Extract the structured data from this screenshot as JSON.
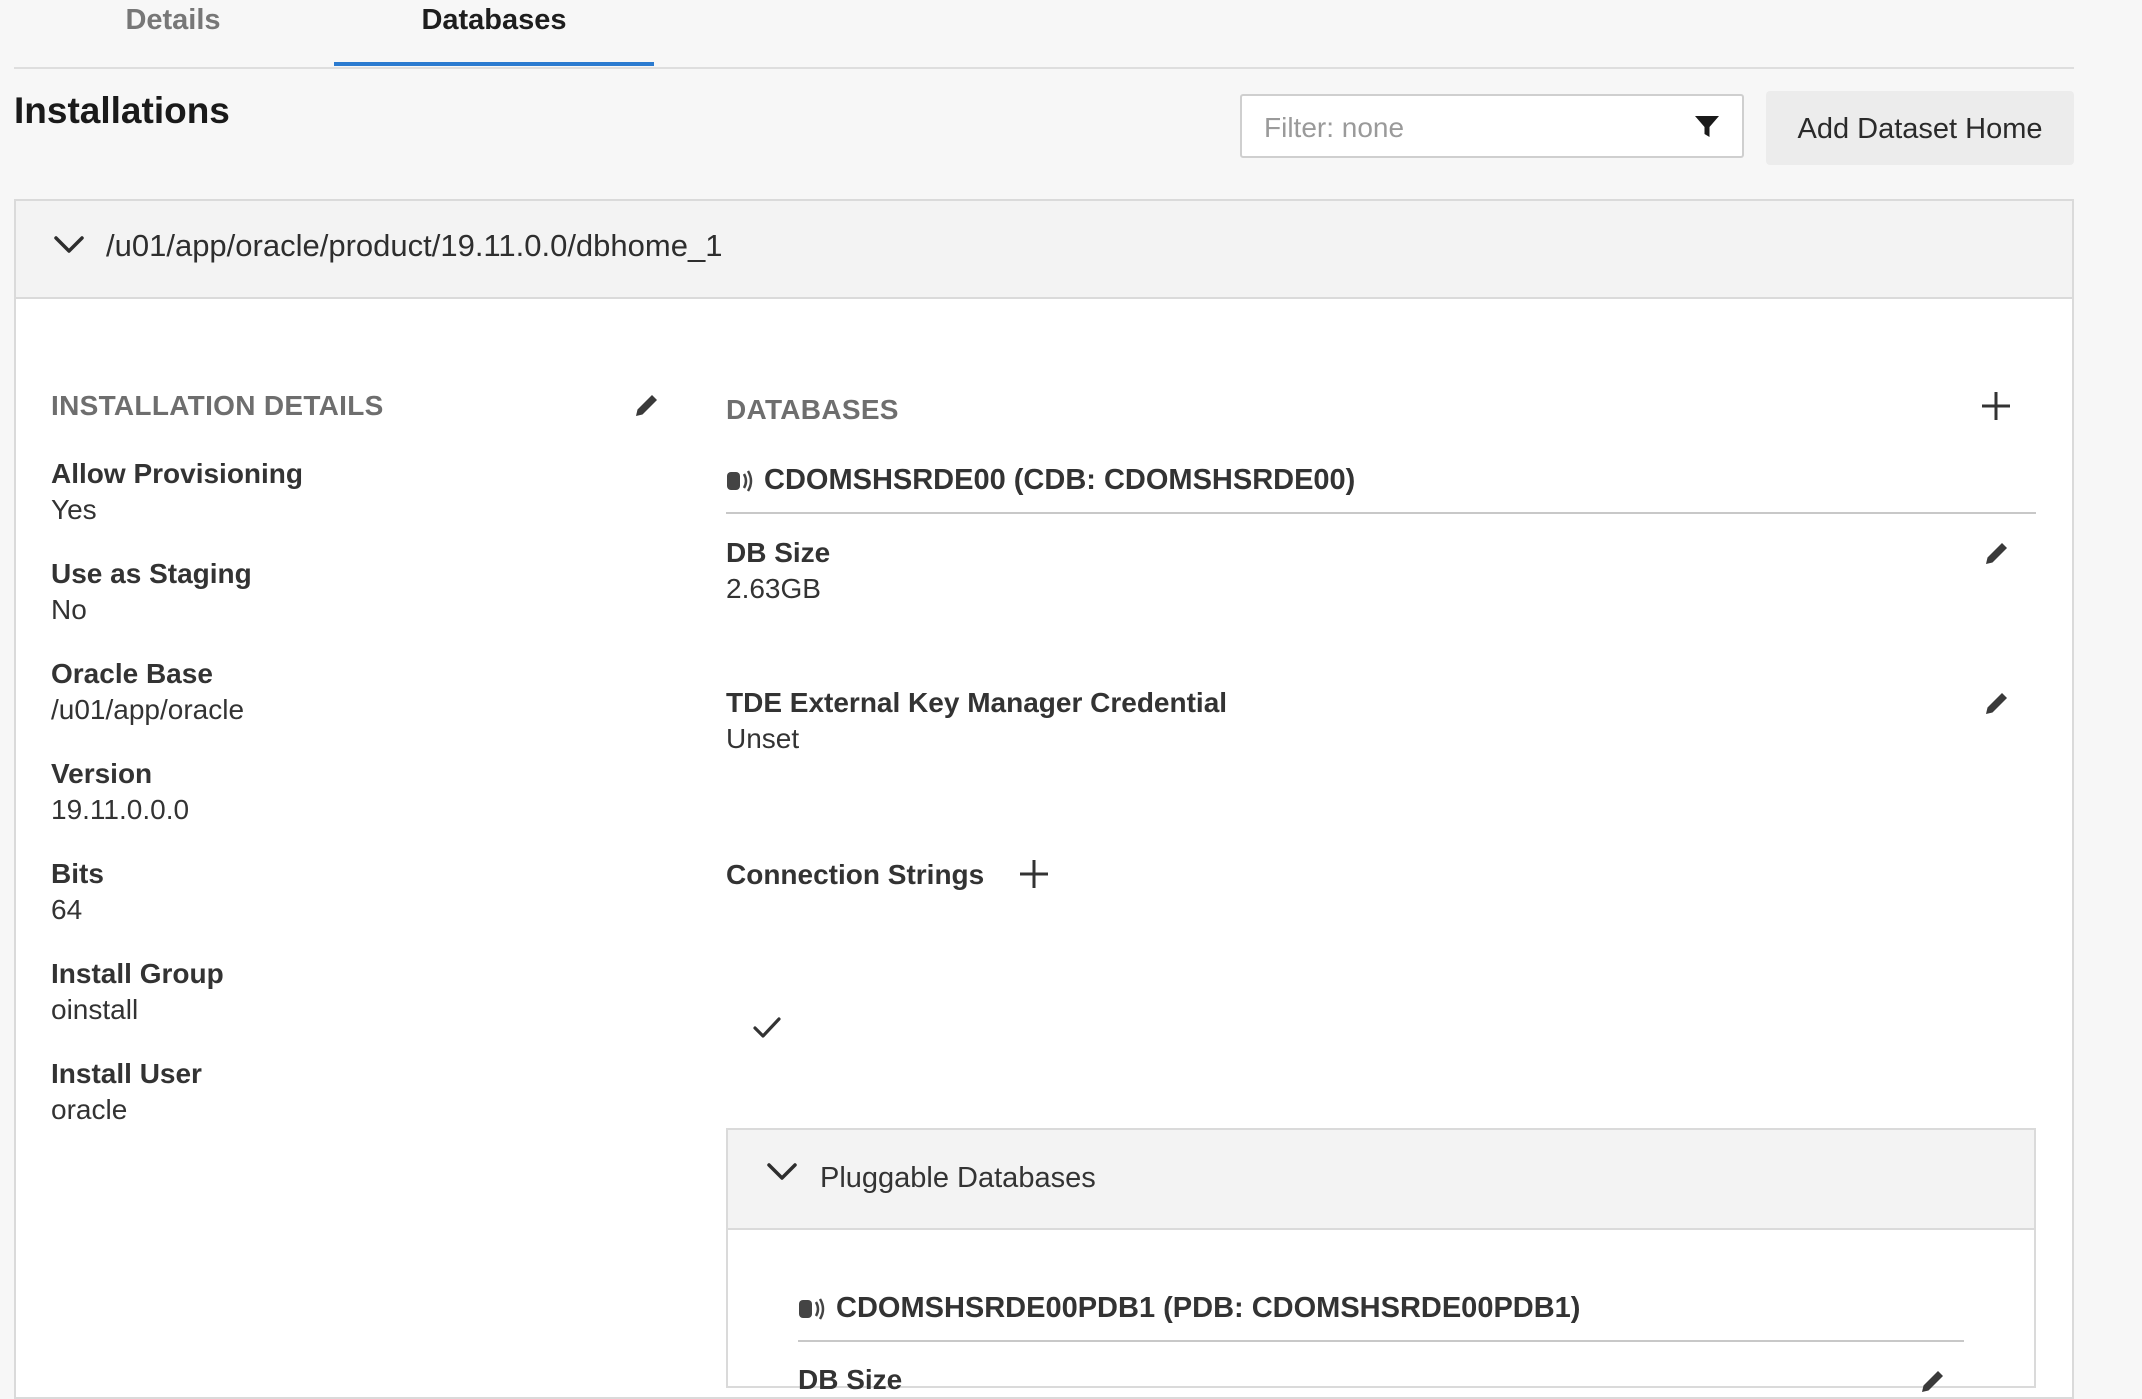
{
  "tabs": [
    {
      "label": "Details"
    },
    {
      "label": "Databases"
    }
  ],
  "page": {
    "title": "Installations"
  },
  "filter": {
    "placeholder": "Filter: none",
    "value": ""
  },
  "add_button": {
    "label": "Add Dataset Home"
  },
  "installation": {
    "path": "/u01/app/oracle/product/19.11.0.0/dbhome_1",
    "details": {
      "title": "INSTALLATION DETAILS",
      "fields": [
        {
          "label": "Allow Provisioning",
          "value": "Yes"
        },
        {
          "label": "Use as Staging",
          "value": "No"
        },
        {
          "label": "Oracle Base",
          "value": "/u01/app/oracle"
        },
        {
          "label": "Version",
          "value": "19.11.0.0.0"
        },
        {
          "label": "Bits",
          "value": "64"
        },
        {
          "label": "Install Group",
          "value": "oinstall"
        },
        {
          "label": "Install User",
          "value": "oracle"
        }
      ]
    },
    "databases": {
      "title": "DATABASES",
      "db": {
        "name": "CDOMSHSRDE00 (CDB: CDOMSHSRDE00)",
        "size_label": "DB Size",
        "size_value": "2.63GB",
        "tde_label": "TDE External Key Manager Credential",
        "tde_value": "Unset",
        "conn_label": "Connection Strings"
      },
      "pluggable": {
        "title": "Pluggable Databases",
        "pdb_name": "CDOMSHSRDE00PDB1 (PDB: CDOMSHSRDE00PDB1)",
        "size_label": "DB Size"
      }
    }
  },
  "icons": {
    "filter": "filter-icon",
    "edit": "pencil-icon",
    "add": "plus-icon",
    "collapse": "chevron-down-icon",
    "database": "database-icon",
    "check": "checkmark-icon"
  },
  "colors": {
    "accent": "#2b7bd0",
    "background": "#f7f7f7",
    "panel_header": "#f3f3f3"
  }
}
